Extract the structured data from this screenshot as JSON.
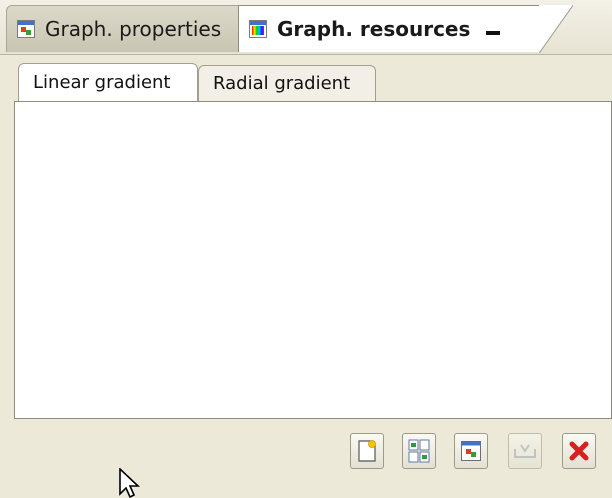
{
  "view_tabs": [
    {
      "label": "Graph. properties",
      "icon": "graph-properties-icon"
    },
    {
      "label": "Graph. resources",
      "icon": "graph-resources-icon"
    }
  ],
  "subtabs": [
    {
      "label": "Linear gradient"
    },
    {
      "label": "Radial gradient"
    }
  ],
  "toolbar": {
    "buttons": [
      {
        "icon": "new-resource-icon",
        "enabled": true
      },
      {
        "icon": "duplicate-icon",
        "enabled": true
      },
      {
        "icon": "graph-properties-icon",
        "enabled": true
      },
      {
        "icon": "import-icon",
        "enabled": false
      },
      {
        "icon": "delete-icon",
        "enabled": true
      }
    ]
  },
  "colors": {
    "panel_bg": "#ece9d8",
    "delete_red": "#d82020",
    "accent_blue": "#3d74c9"
  }
}
